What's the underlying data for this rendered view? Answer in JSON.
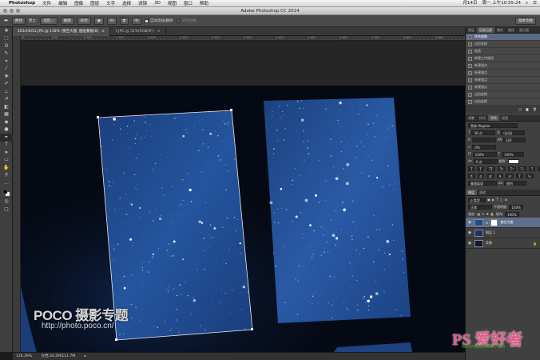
{
  "menubar": {
    "app_name": "Photoshop",
    "items": [
      "文件",
      "编辑",
      "图像",
      "图层",
      "文字",
      "选择",
      "滤镜",
      "3D",
      "视图",
      "窗口",
      "帮助"
    ],
    "clock": "周一 上午10:55:24",
    "date": "月14日"
  },
  "window": {
    "title": "Adobe Photoshop CC 2014"
  },
  "options": {
    "mode_select": "路径",
    "make_label": "建立:",
    "selection_button": "选区...",
    "mask_button": "蒙版",
    "shape_button": "形状",
    "auto_add_delete": "自动添加/删除",
    "align_edges": "对齐边缘",
    "workspace": "基本功能"
  },
  "tabs": [
    {
      "label": "1D1A3051.JPG @ 118% (夜空大图, 图层蒙版/8)",
      "close": "×"
    },
    {
      "label": "7.JPG @ 31%(RGB/8*)",
      "close": "×"
    }
  ],
  "ruler_ticks": [
    "0",
    "50",
    "100",
    "150",
    "200",
    "250",
    "300",
    "350",
    "400",
    "450",
    "500",
    "550",
    "600",
    "650"
  ],
  "status": {
    "zoom": "118.39%",
    "doc": "文档:34.2M/111.7M"
  },
  "history_panel": {
    "tabs": [
      "图层",
      "历史记录",
      "属性",
      "路径",
      "直方图"
    ],
    "items": [
      "拼合图像",
      "自由变换",
      "粘贴",
      "新建工作路径",
      "新建锚点",
      "新建锚点",
      "新建锚点",
      "新建锚点",
      "自由变换",
      "自由变换"
    ],
    "active_index": 0
  },
  "character_panel": {
    "tabs": [
      "调整",
      "样式",
      "字符",
      "段落"
    ],
    "font_family": "黑体 Regular",
    "font_size": "36 点",
    "leading": "(自动)",
    "tracking": "320",
    "kerning": "0%",
    "scale_v": "100%",
    "scale_h": "100%",
    "baseline": "0 点",
    "color_label": "颜色:",
    "language": "美国英语",
    "antialias": "锐利"
  },
  "layers_panel": {
    "filter": "ρ 类型",
    "blend_mode": "正常",
    "opacity_label": "不透明度:",
    "opacity": "100%",
    "lock_label": "锁定:",
    "fill_label": "填充:",
    "fill": "100%",
    "layers": [
      {
        "name": "夜空大图",
        "active": true,
        "has_mask": true
      },
      {
        "name": "图层 1",
        "active": false,
        "has_mask": false
      },
      {
        "name": "背景",
        "active": false,
        "has_mask": false
      }
    ],
    "footer_icons": [
      "link-icon",
      "fx-icon",
      "mask-icon",
      "adjustment-icon",
      "folder-icon",
      "new-layer-icon",
      "trash-icon"
    ]
  },
  "watermarks": {
    "poco": "POCO 摄影专题",
    "poco_url": "http://photo.poco.cn/",
    "ps_logo": "PS 爱好者",
    "ps_url": "www.psahz.com"
  },
  "colors": {
    "accent": "#5d6f8d",
    "sky_blue": "#1f4a8f",
    "sky_dark": "#050913"
  }
}
